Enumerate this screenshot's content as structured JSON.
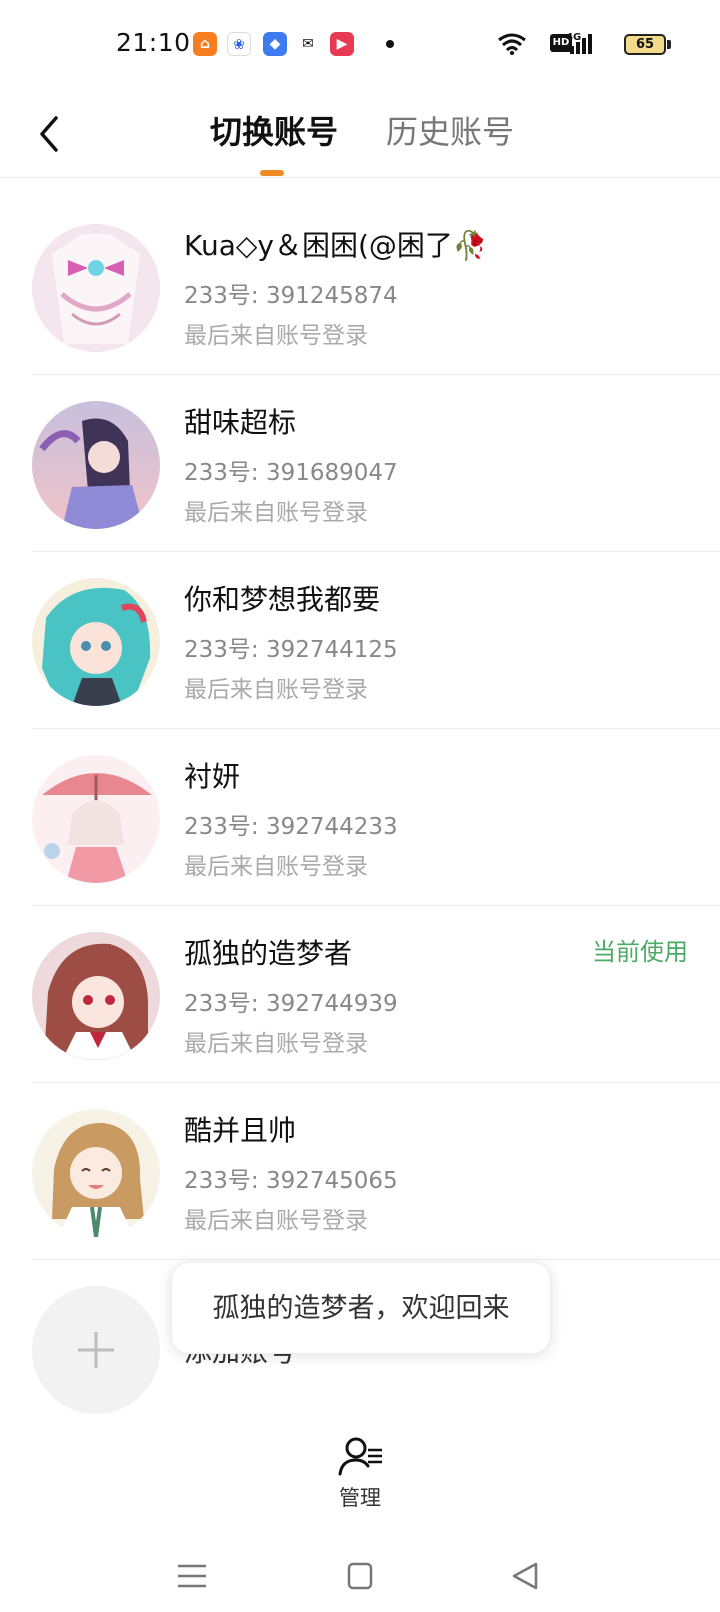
{
  "status_bar": {
    "time": "21:10",
    "battery": "65",
    "network": "4G",
    "hd_label": "HD",
    "notification_icons": [
      "taobao-icon",
      "baidu-icon",
      "feishu-icon",
      "wechat-icon",
      "video-icon"
    ]
  },
  "header": {
    "tabs": [
      {
        "label": "切换账号",
        "active": true
      },
      {
        "label": "历史账号",
        "active": false
      }
    ],
    "accent_color": "#f08a24"
  },
  "accounts": [
    {
      "name": "Kua◇y＆困困(@困了🥀",
      "id": "233号: 391245874",
      "login": "最后来自账号登录",
      "current": ""
    },
    {
      "name": "甜味超标",
      "id": "233号: 391689047",
      "login": "最后来自账号登录",
      "current": ""
    },
    {
      "name": "你和梦想我都要",
      "id": "233号: 392744125",
      "login": "最后来自账号登录",
      "current": ""
    },
    {
      "name": "衬妍",
      "id": "233号: 392744233",
      "login": "最后来自账号登录",
      "current": ""
    },
    {
      "name": "孤独的造梦者",
      "id": "233号: 392744939",
      "login": "最后来自账号登录",
      "current": "当前使用"
    },
    {
      "name": "酷并且帅",
      "id": "233号: 392745065",
      "login": "最后来自账号登录",
      "current": ""
    }
  ],
  "add_account": {
    "label": "添加账号"
  },
  "toast": {
    "text": "孤独的造梦者，欢迎回来"
  },
  "manage": {
    "label": "管理"
  },
  "colors": {
    "current_badge": "#4caa64"
  }
}
